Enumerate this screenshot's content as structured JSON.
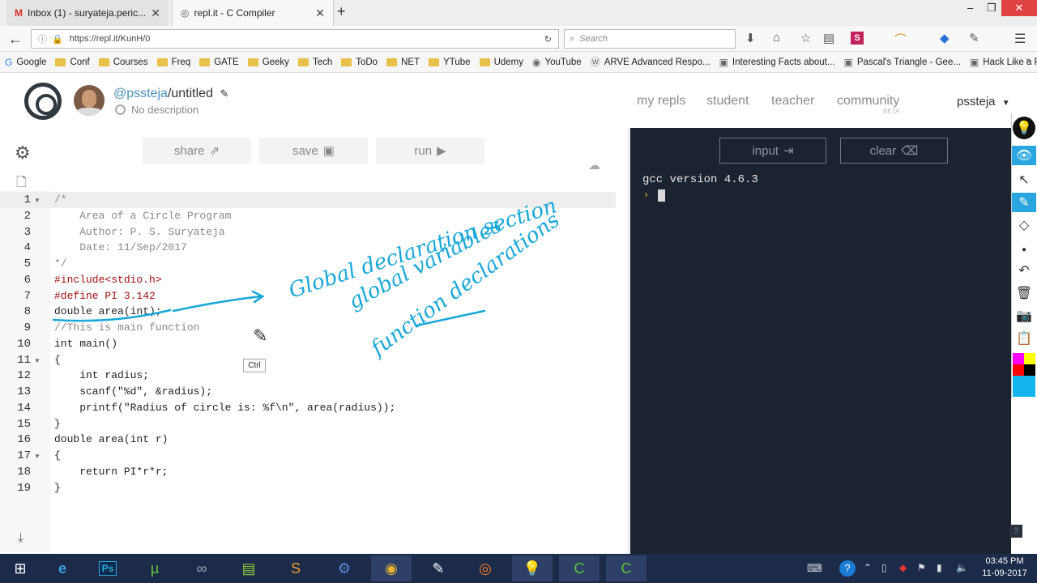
{
  "browser": {
    "tabs": [
      {
        "title": "Inbox (1) - suryateja.peric...",
        "icon": "gmail-icon"
      },
      {
        "title": "repl.it - C Compiler",
        "icon": "replit-icon"
      }
    ],
    "url": "https://repl.it/KunH/0",
    "search_placeholder": "Search",
    "bookmarks": [
      {
        "label": "Google",
        "icon": "google-icon"
      },
      {
        "label": "Conf",
        "icon": "folder-icon"
      },
      {
        "label": "Courses",
        "icon": "folder-icon"
      },
      {
        "label": "Freq",
        "icon": "folder-icon"
      },
      {
        "label": "GATE",
        "icon": "folder-icon"
      },
      {
        "label": "Geeky",
        "icon": "folder-icon"
      },
      {
        "label": "Tech",
        "icon": "folder-icon"
      },
      {
        "label": "ToDo",
        "icon": "folder-icon"
      },
      {
        "label": "NET",
        "icon": "folder-icon"
      },
      {
        "label": "YTube",
        "icon": "folder-icon"
      },
      {
        "label": "Udemy",
        "icon": "folder-icon"
      },
      {
        "label": "YouTube",
        "icon": "globe-icon"
      },
      {
        "label": "ARVE Advanced Respo...",
        "icon": "wordpress-icon"
      },
      {
        "label": "Interesting Facts about...",
        "icon": "page-icon"
      },
      {
        "label": "Pascal's Triangle - Gee...",
        "icon": "page-icon"
      },
      {
        "label": "Hack Like a Pro: Denial...",
        "icon": "page-icon"
      }
    ]
  },
  "repl": {
    "user": "@pssteja",
    "name": "/untitled",
    "description": "No description",
    "nav": [
      "my repls",
      "student",
      "teacher",
      "community"
    ],
    "community_badge": "BETA",
    "account": "pssteja",
    "buttons": {
      "share": "share",
      "save": "save",
      "run": "run",
      "input": "input",
      "clear": "clear"
    }
  },
  "code_lines": [
    "/*",
    "    Area of a Circle Program",
    "    Author: P. S. Suryateja",
    "    Date: 11/Sep/2017",
    "*/",
    "#include<stdio.h>",
    "#define PI 3.142",
    "double area(int);",
    "//This is main function",
    "int main()",
    "{",
    "    int radius;",
    "    scanf(\"%d\", &radius);",
    "    printf(\"Radius of circle is: %f\\n\", area(radius));",
    "}",
    "double area(int r)",
    "{",
    "    return PI*r*r;",
    "}"
  ],
  "console": {
    "output": "gcc version 4.6.3",
    "prompt": "›"
  },
  "annotations": {
    "handwriting": [
      "Global declaration section",
      "global variables",
      "function declarations"
    ],
    "ink_color": "#1aa7d8",
    "tooltip": "Ctrl"
  },
  "taskbar": {
    "apps": [
      "windows-start-icon",
      "internet-explorer-icon",
      "photoshop-icon",
      "utorrent-icon",
      "app-icon",
      "notepad-plus-icon",
      "sublime-text-icon",
      "app-icon",
      "chrome-icon",
      "app-icon",
      "firefox-icon",
      "app-icon",
      "camtasia-icon",
      "camtasia-icon"
    ],
    "time": "03:45 PM",
    "date": "11-09-2017"
  }
}
